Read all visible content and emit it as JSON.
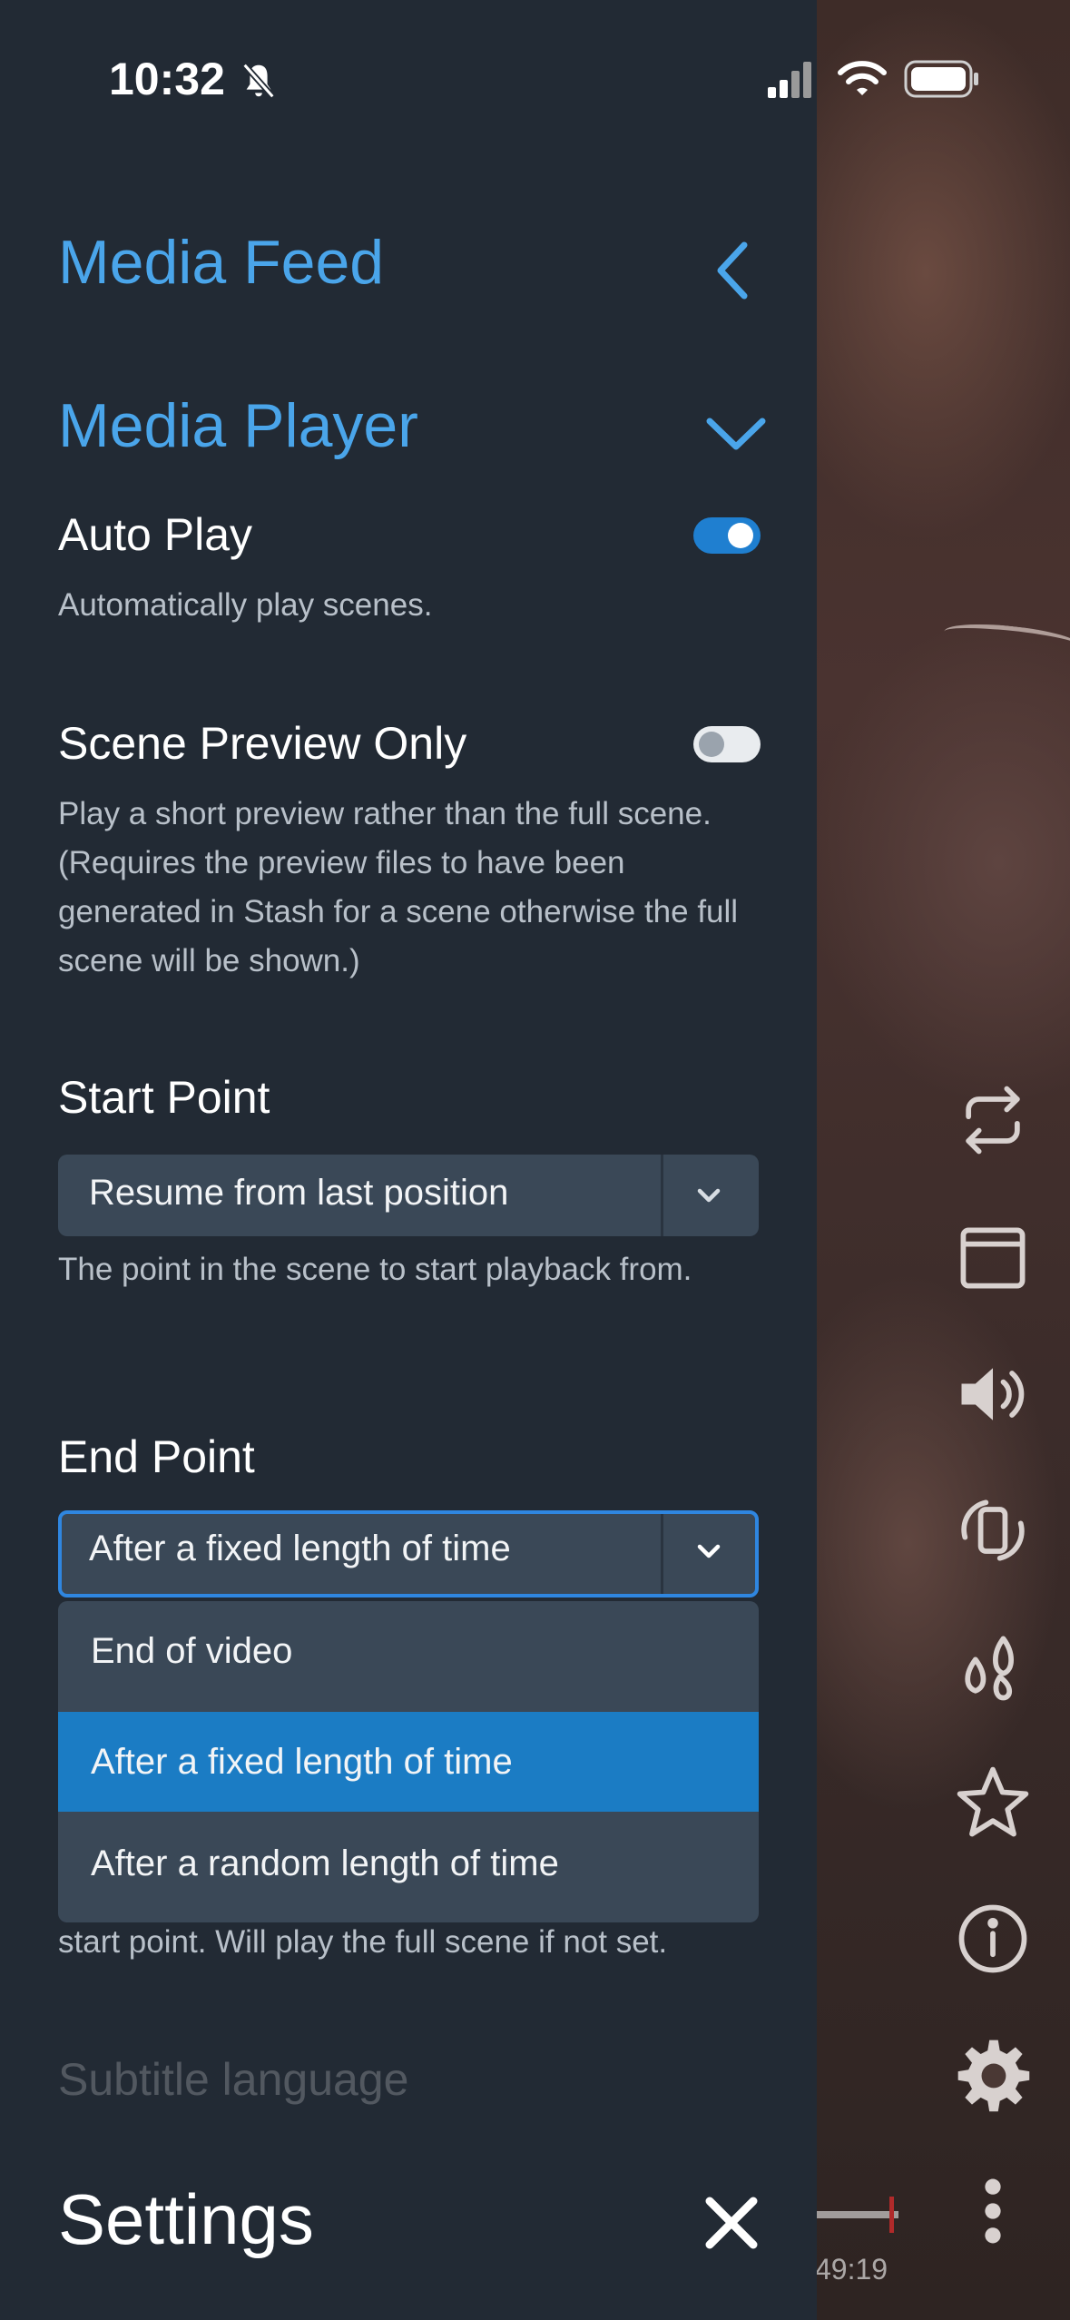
{
  "status_bar": {
    "time": "10:32",
    "icons": [
      "bell-slash-icon",
      "cellular-signal-icon",
      "wifi-icon",
      "battery-icon"
    ]
  },
  "panel": {
    "sections": [
      {
        "title": "Media Feed",
        "icon": "chevron-left-icon"
      },
      {
        "title": "Media Player",
        "icon": "chevron-down-icon"
      }
    ],
    "auto_play": {
      "label": "Auto Play",
      "description": "Automatically play scenes.",
      "enabled": true
    },
    "scene_preview_only": {
      "label": "Scene Preview Only",
      "description": "Play a short preview rather than the full scene. (Requires the preview files to have been generated in Stash for a scene otherwise the full scene will be shown.)",
      "enabled": false
    },
    "start_point": {
      "label": "Start Point",
      "value": "Resume from last position",
      "description": "The point in the scene to start playback from."
    },
    "end_point": {
      "label": "End Point",
      "value": "After a fixed length of time",
      "options": [
        "End of video",
        "After a fixed length of time",
        "After a random length of time"
      ],
      "selected_index": 1,
      "description_visible": "start point. Will play the full scene if not set."
    },
    "next_setting_label": "Subtitle language",
    "footer": {
      "title": "Settings",
      "close_icon": "close-icon"
    }
  },
  "video_controls": {
    "icons": [
      "repeat-icon",
      "window-icon",
      "volume-icon",
      "rotate-device-icon",
      "drops-icon",
      "star-icon",
      "info-icon",
      "gear-icon",
      "more-vertical-icon"
    ],
    "time": "49:19"
  },
  "colors": {
    "panel_bg": "#222a34",
    "accent": "#4aa5ea",
    "toggle_on": "#1f7fd0",
    "select_bg": "#3a4857",
    "selected_option": "#1b7cc4"
  }
}
